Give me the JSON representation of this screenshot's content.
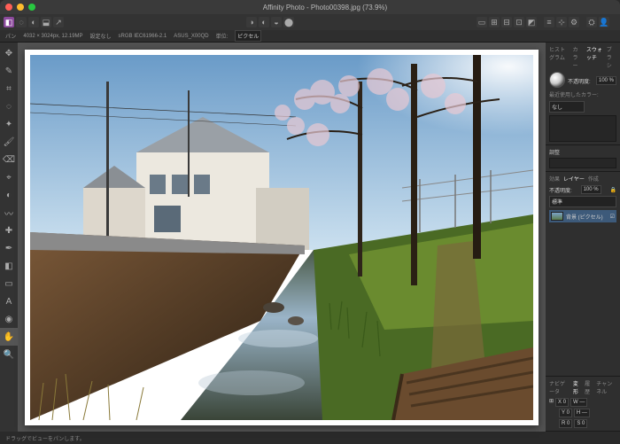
{
  "titlebar": {
    "title": "Affinity Photo - Photo00398.jpg (73.9%)"
  },
  "contextbar": {
    "tool_name": "パン",
    "dims": "4032 × 3024px, 12.19MP",
    "dpi": "設定なし",
    "profile": "sRGB IEC61966-2.1",
    "camera": "ASUS_X00QD",
    "unit_label": "単位:",
    "unit_value": "ピクセル"
  },
  "toolbar": {
    "personas": [
      "photo",
      "liquify",
      "develop",
      "tone",
      "export"
    ],
    "right_labels": [
      "環境設定"
    ]
  },
  "tools": [
    {
      "name": "move-tool",
      "glyph": "✥"
    },
    {
      "name": "artistic-text-tool",
      "glyph": "✎"
    },
    {
      "name": "crop-tool",
      "glyph": "⌗"
    },
    {
      "name": "selection-brush-tool",
      "glyph": "◌"
    },
    {
      "name": "flood-select-tool",
      "glyph": "✦"
    },
    {
      "name": "paint-brush-tool",
      "glyph": "🖌"
    },
    {
      "name": "erase-brush-tool",
      "glyph": "⌫"
    },
    {
      "name": "clone-brush-tool",
      "glyph": "⌖"
    },
    {
      "name": "dodge-brush-tool",
      "glyph": "◐"
    },
    {
      "name": "smudge-brush-tool",
      "glyph": "〰"
    },
    {
      "name": "healing-brush-tool",
      "glyph": "✚"
    },
    {
      "name": "pen-tool",
      "glyph": "✒"
    },
    {
      "name": "gradient-tool",
      "glyph": "◧"
    },
    {
      "name": "rectangle-tool",
      "glyph": "▭"
    },
    {
      "name": "text-tool",
      "glyph": "A"
    },
    {
      "name": "color-picker-tool",
      "glyph": "◉"
    },
    {
      "name": "view-tool",
      "glyph": "✋",
      "selected": true
    },
    {
      "name": "zoom-tool",
      "glyph": "🔍"
    }
  ],
  "panels": {
    "histogram": {
      "tabs": [
        "ヒストグラム",
        "カラー",
        "スウォッチ",
        "ブラシ"
      ],
      "active": 2,
      "opacity_label": "不透明度:",
      "opacity_value": "100 %",
      "recent_label": "最近使用したカラー:",
      "picker_label": "なし"
    },
    "adjustments": {
      "tab": "調整",
      "empty": ""
    },
    "layers": {
      "tabs": [
        "効果",
        "レイヤー",
        "作成"
      ],
      "active": 1,
      "opacity_label": "不透明度:",
      "opacity_value": "100 %",
      "blend_label": "標準",
      "layer_name": "背景 (ピクセル)"
    },
    "transform": {
      "tabs": [
        "ナビゲータ",
        "変形",
        "履歴",
        "チャンネル"
      ],
      "active": 1,
      "X": "0",
      "Y": "0",
      "W": "—",
      "H": "—",
      "R": "0",
      "S": "0"
    },
    "navigator": {}
  },
  "status": {
    "hint": "ドラッグでビューをパンします。"
  },
  "photo_colors": {
    "sky1": "#79a7d0",
    "sky2": "#b7d1e6",
    "house": "#e6e3da",
    "roof": "#8a8f94",
    "wall1": "#6b4a2c",
    "wall2": "#3a2a18",
    "water1": "#5a6a58",
    "water2": "#2e3a30",
    "grass1": "#6a8b2f",
    "grass2": "#2f4a18",
    "wood": "#7a5a38",
    "tree": "#4a3a2a",
    "blossom": "#e8c8d0"
  }
}
